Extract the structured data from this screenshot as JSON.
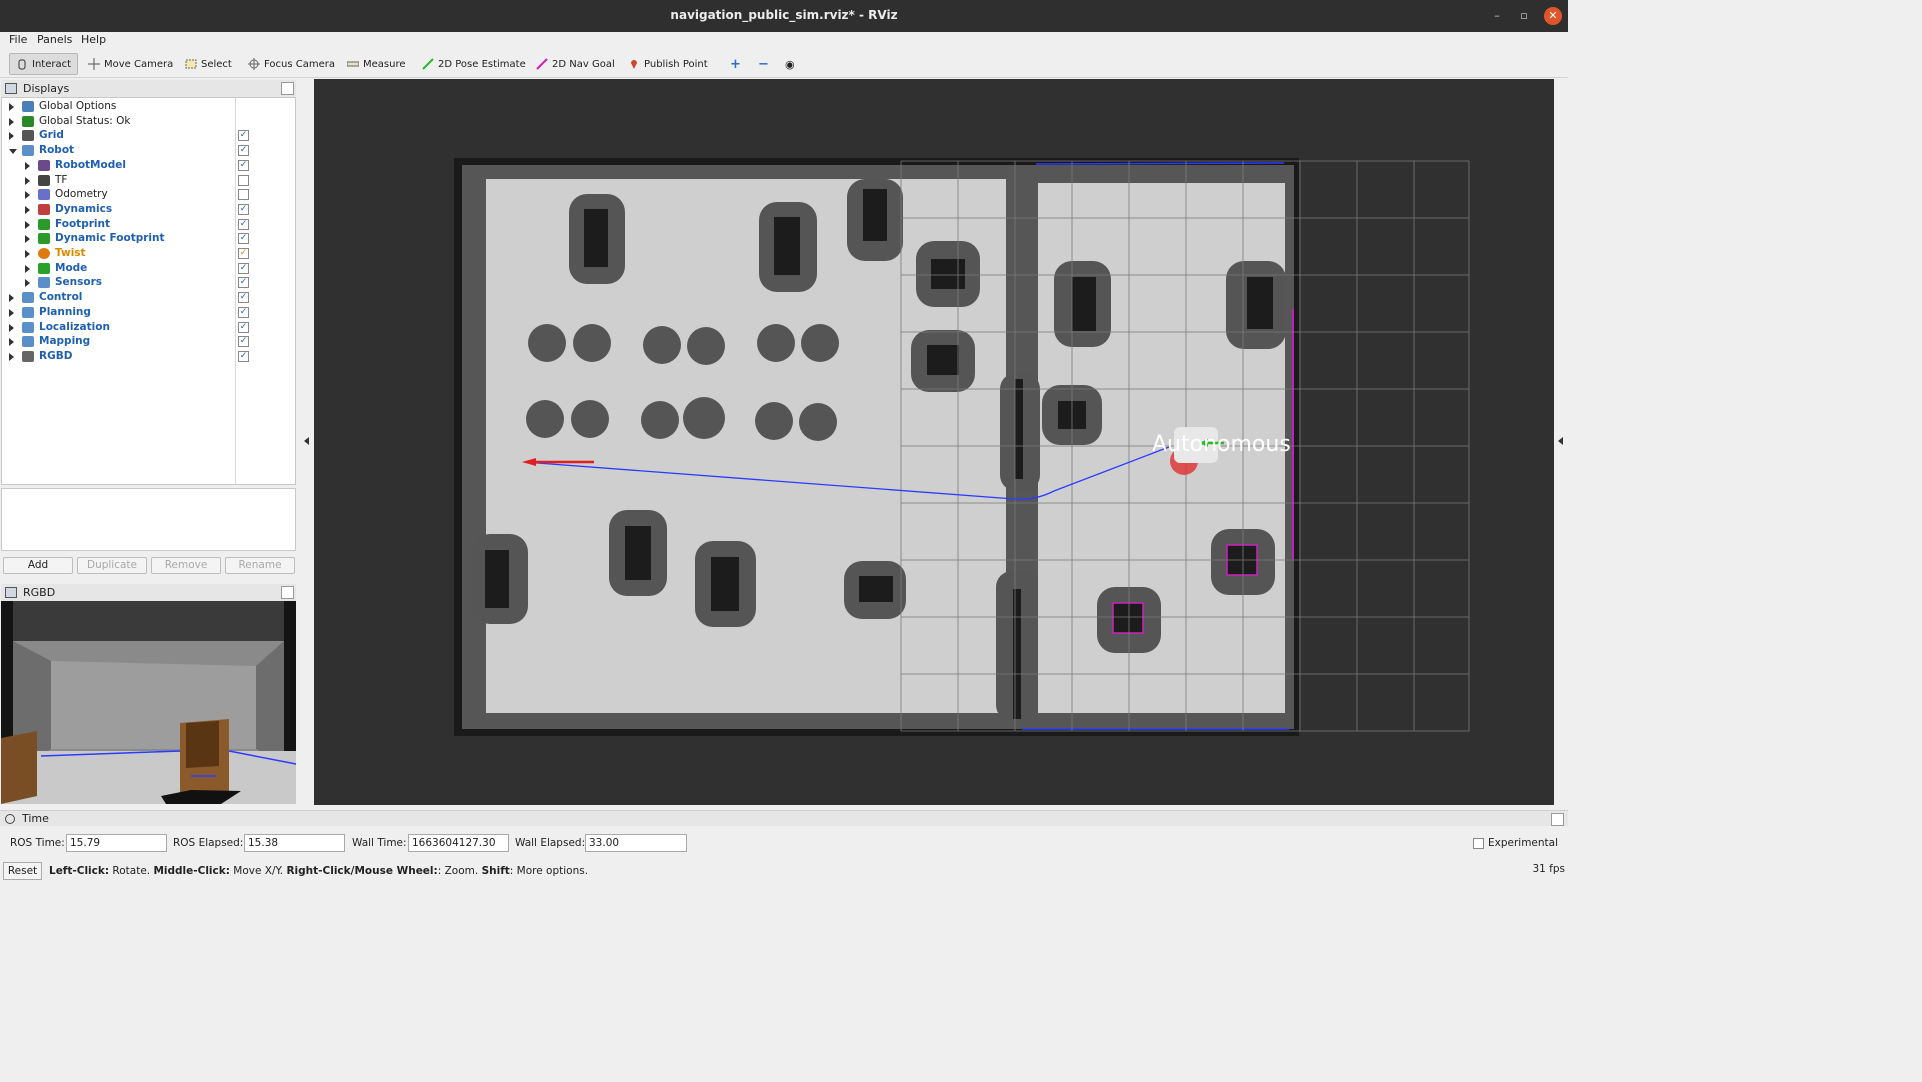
{
  "window": {
    "title": "navigation_public_sim.rviz* - RViz"
  },
  "menu": [
    "File",
    "Panels",
    "Help"
  ],
  "toolbar": {
    "tools": [
      "Interact",
      "Move Camera",
      "Select",
      "Focus Camera",
      "Measure",
      "2D Pose Estimate",
      "2D Nav Goal",
      "Publish Point"
    ],
    "active_tool": "Interact"
  },
  "displays": {
    "title": "Displays",
    "items": [
      {
        "label": "Global Options",
        "level": 0,
        "expanded": false,
        "checked": null,
        "style": "plain",
        "icon": "gear-icon"
      },
      {
        "label": "Global Status: Ok",
        "level": 0,
        "expanded": false,
        "checked": null,
        "style": "plain",
        "icon": "check-icon"
      },
      {
        "label": "Grid",
        "level": 0,
        "expanded": false,
        "checked": true,
        "style": "blue",
        "icon": "grid-icon"
      },
      {
        "label": "Robot",
        "level": 0,
        "expanded": true,
        "checked": true,
        "style": "blue",
        "icon": "folder-icon"
      },
      {
        "label": "RobotModel",
        "level": 1,
        "expanded": false,
        "checked": true,
        "style": "blue",
        "icon": "robot-icon"
      },
      {
        "label": "TF",
        "level": 1,
        "expanded": false,
        "checked": false,
        "style": "plain",
        "icon": "tf-axes-icon"
      },
      {
        "label": "Odometry",
        "level": 1,
        "expanded": false,
        "checked": false,
        "style": "plain",
        "icon": "diamond-icon"
      },
      {
        "label": "Dynamics",
        "level": 1,
        "expanded": false,
        "checked": true,
        "style": "blue",
        "icon": "balls-icon"
      },
      {
        "label": "Footprint",
        "level": 1,
        "expanded": false,
        "checked": true,
        "style": "blue",
        "icon": "polygon-icon"
      },
      {
        "label": "Dynamic Footprint",
        "level": 1,
        "expanded": false,
        "checked": true,
        "style": "blue",
        "icon": "polygon-icon"
      },
      {
        "label": "Twist",
        "level": 1,
        "expanded": false,
        "checked": true,
        "style": "orange",
        "icon": "warning-icon"
      },
      {
        "label": "Mode",
        "level": 1,
        "expanded": false,
        "checked": true,
        "style": "blue",
        "icon": "cube-icon"
      },
      {
        "label": "Sensors",
        "level": 1,
        "expanded": false,
        "checked": true,
        "style": "blue",
        "icon": "folder-icon"
      },
      {
        "label": "Control",
        "level": 0,
        "expanded": false,
        "checked": true,
        "style": "blue",
        "icon": "folder-icon"
      },
      {
        "label": "Planning",
        "level": 0,
        "expanded": false,
        "checked": true,
        "style": "blue",
        "icon": "folder-icon"
      },
      {
        "label": "Localization",
        "level": 0,
        "expanded": false,
        "checked": true,
        "style": "blue",
        "icon": "folder-icon"
      },
      {
        "label": "Mapping",
        "level": 0,
        "expanded": false,
        "checked": true,
        "style": "blue",
        "icon": "folder-icon"
      },
      {
        "label": "RGBD",
        "level": 0,
        "expanded": false,
        "checked": true,
        "style": "blue",
        "icon": "camera-icon"
      }
    ],
    "buttons": {
      "add": "Add",
      "duplicate": "Duplicate",
      "remove": "Remove",
      "rename": "Rename"
    }
  },
  "rgbd_panel": {
    "title": "RGBD"
  },
  "viewport": {
    "overlay_text": "Autonomous"
  },
  "time_panel": {
    "title": "Time",
    "ros_time_label": "ROS Time:",
    "ros_time": "15.79",
    "ros_elapsed_label": "ROS Elapsed:",
    "ros_elapsed": "15.38",
    "wall_time_label": "Wall Time:",
    "wall_time": "1663604127.30",
    "wall_elapsed_label": "Wall Elapsed:",
    "wall_elapsed": "33.00",
    "experimental_label": "Experimental"
  },
  "status": {
    "reset": "Reset",
    "help_b1": "Left-Click:",
    "help_t1": " Rotate. ",
    "help_b2": "Middle-Click:",
    "help_t2": " Move X/Y. ",
    "help_b3": "Right-Click/Mouse Wheel:",
    "help_t3": ": Zoom. ",
    "help_b4": "Shift",
    "help_t4": ": More options.",
    "fps": "31 fps"
  },
  "colors": {
    "title_bar": "#2f2f2f",
    "close_button": "#e0562a",
    "link_blue": "#1f5fb0",
    "twist_orange": "#d98a00",
    "path_blue": "#2a3cff",
    "goal_red": "#e02020"
  }
}
